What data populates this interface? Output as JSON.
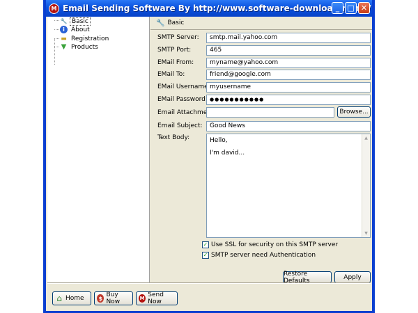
{
  "window": {
    "title": "Email Sending Software  By http://www.software-download.name/",
    "app_icon_glyph": "M",
    "minimize_glyph": "_",
    "maximize_glyph": "□",
    "close_glyph": "✕"
  },
  "sidebar": {
    "items": [
      {
        "label": "Basic",
        "icon": "wrench-icon",
        "glyph": "🔧",
        "selected": true
      },
      {
        "label": "About",
        "icon": "info-icon",
        "glyph": "i"
      },
      {
        "label": "Registration",
        "icon": "registration-icon",
        "glyph": "▬"
      },
      {
        "label": "Products",
        "icon": "arrow-down-icon",
        "glyph": "▼"
      }
    ]
  },
  "panel": {
    "header": "Basic",
    "header_icon_glyph": "🔧",
    "fields": {
      "smtp_server": {
        "label": "SMTP Server:",
        "value": "smtp.mail.yahoo.com"
      },
      "smtp_port": {
        "label": "SMTP Port:",
        "value": "465"
      },
      "email_from": {
        "label": "EMail From:",
        "value": "myname@yahoo.com"
      },
      "email_to": {
        "label": "EMail To:",
        "value": "friend@google.com"
      },
      "email_username": {
        "label": "EMail Username:",
        "value": "myusername"
      },
      "email_password": {
        "label": "EMail Password:",
        "value": "●●●●●●●●●●●"
      },
      "email_attachment": {
        "label": "Email Attachment:",
        "value": ""
      },
      "email_subject": {
        "label": "Email Subject:",
        "value": "Good News"
      }
    },
    "browse_label": "Browse...",
    "text_body_label": "Text Body:",
    "text_body_lines": [
      "Hello,",
      "I'm david..."
    ],
    "scroll_up_glyph": "▲",
    "scroll_down_glyph": "▼",
    "use_ssl_label": "Use SSL for security on this SMTP server",
    "use_ssl_checked": true,
    "smtp_auth_label": "SMTP server need Authentication",
    "smtp_auth_checked": true,
    "check_glyph": "✓",
    "restore_defaults_label": "Restore Defaults",
    "apply_label": "Apply"
  },
  "footer": {
    "home_label": "Home",
    "home_glyph": "⌂",
    "buy_now_label": "Buy Now",
    "buy_now_glyph": "$",
    "send_now_label": "Send Now",
    "send_now_glyph": "M"
  },
  "colors": {
    "titlebar": "#0a52df",
    "window_bg": "#ece9d8",
    "close_button": "#c63b14",
    "input_border": "#7f9db9",
    "checkmark": "#21a121"
  }
}
